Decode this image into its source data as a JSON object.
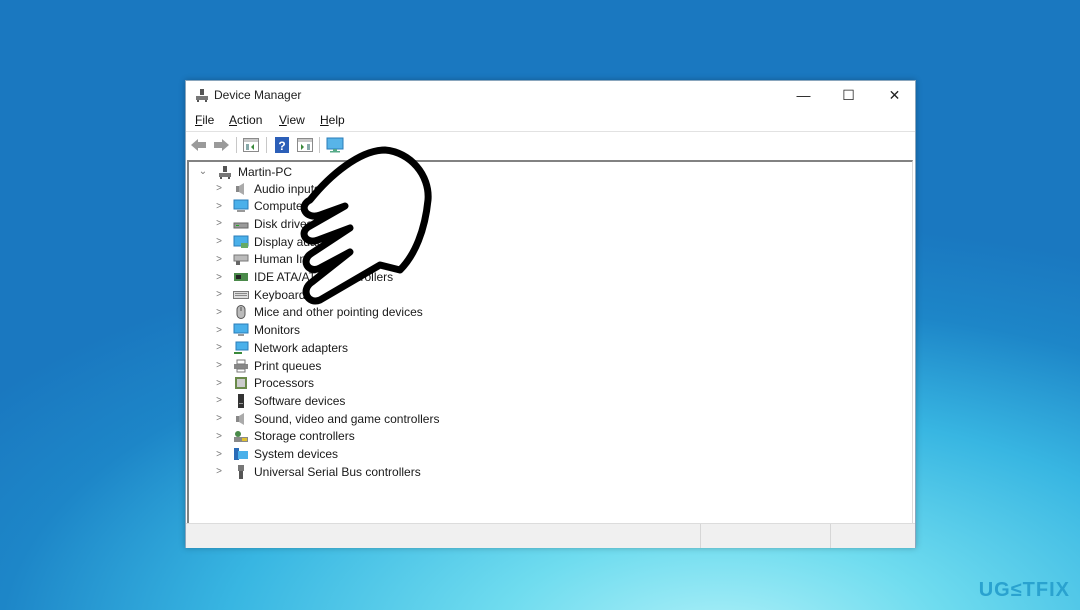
{
  "window": {
    "title": "Device Manager",
    "controls": {
      "minimize": "—",
      "maximize": "☐",
      "close": "✕"
    }
  },
  "menubar": [
    {
      "label": "File",
      "accel": "F",
      "rest": "ile"
    },
    {
      "label": "Action",
      "accel": "A",
      "rest": "ction"
    },
    {
      "label": "View",
      "accel": "V",
      "rest": "iew"
    },
    {
      "label": "Help",
      "accel": "H",
      "rest": "elp"
    }
  ],
  "toolbar": [
    "back-icon",
    "forward-icon",
    "properties-pane-icon",
    "help-icon",
    "update-driver-icon",
    "scan-hardware-icon"
  ],
  "tree": {
    "root": {
      "label": "Martin-PC",
      "expanded": true,
      "icon": "computer-tower-icon"
    },
    "categories": [
      {
        "label": "Audio inputs and outputs",
        "icon": "speaker-icon"
      },
      {
        "label": "Computer",
        "icon": "computer-icon"
      },
      {
        "label": "Disk drives",
        "icon": "disk-drive-icon"
      },
      {
        "label": "Display adapters",
        "icon": "display-adapter-icon"
      },
      {
        "label": "Human Interface Devices",
        "icon": "hid-icon"
      },
      {
        "label": "IDE ATA/ATAPI controllers",
        "icon": "ide-controller-icon"
      },
      {
        "label": "Keyboards",
        "icon": "keyboard-icon"
      },
      {
        "label": "Mice and other pointing devices",
        "icon": "mouse-icon"
      },
      {
        "label": "Monitors",
        "icon": "monitor-icon"
      },
      {
        "label": "Network adapters",
        "icon": "network-adapter-icon"
      },
      {
        "label": "Print queues",
        "icon": "printer-icon"
      },
      {
        "label": "Processors",
        "icon": "processor-icon"
      },
      {
        "label": "Software devices",
        "icon": "software-device-icon"
      },
      {
        "label": "Sound, video and game controllers",
        "icon": "speaker-icon"
      },
      {
        "label": "Storage controllers",
        "icon": "storage-controller-icon"
      },
      {
        "label": "System devices",
        "icon": "system-devices-icon"
      },
      {
        "label": "Universal Serial Bus controllers",
        "icon": "usb-icon"
      }
    ]
  },
  "watermark": "UG≤TFIX",
  "colors": {
    "accent": "#2aa2cf",
    "desktop": "#1a78c0"
  }
}
